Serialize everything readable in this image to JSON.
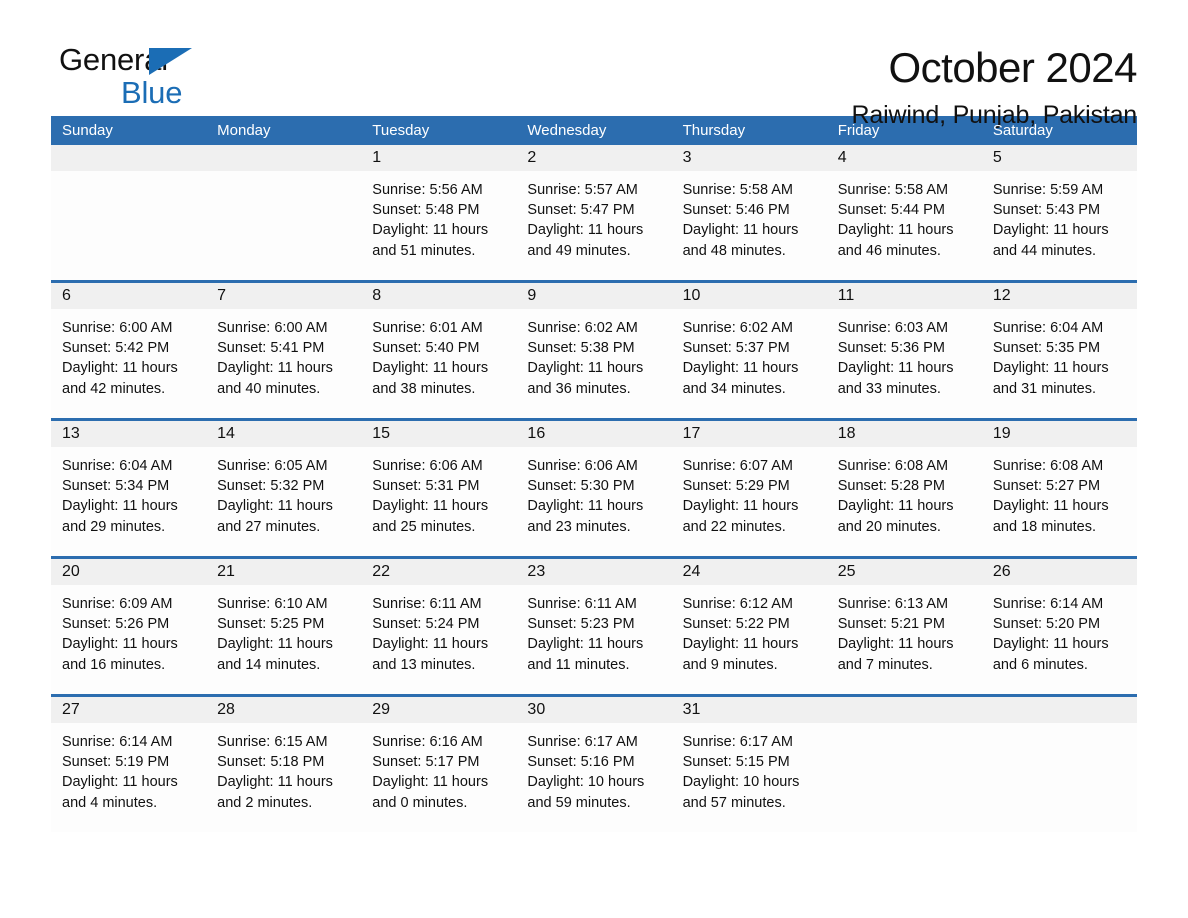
{
  "brand": {
    "word_one": "General",
    "word_two": "Blue",
    "triangle_color": "#1B6DB5"
  },
  "header": {
    "title": "October 2024",
    "subtitle": "Raiwind, Punjab, Pakistan"
  },
  "colors": {
    "header_blue": "#2C6DAF",
    "week_separator": "#2C6DAF",
    "daynum_band": "#F0F0F0",
    "cell_background": "#FDFDFD",
    "text": "#111111",
    "header_text": "#FFFFFF"
  },
  "calendar": {
    "day_headers": [
      "Sunday",
      "Monday",
      "Tuesday",
      "Wednesday",
      "Thursday",
      "Friday",
      "Saturday"
    ],
    "weeks": [
      {
        "days": [
          {
            "num": "",
            "empty": true
          },
          {
            "num": "",
            "empty": true
          },
          {
            "num": "1",
            "sunrise": "Sunrise: 5:56 AM",
            "sunset": "Sunset: 5:48 PM",
            "daylight_1": "Daylight: 11 hours",
            "daylight_2": "and 51 minutes."
          },
          {
            "num": "2",
            "sunrise": "Sunrise: 5:57 AM",
            "sunset": "Sunset: 5:47 PM",
            "daylight_1": "Daylight: 11 hours",
            "daylight_2": "and 49 minutes."
          },
          {
            "num": "3",
            "sunrise": "Sunrise: 5:58 AM",
            "sunset": "Sunset: 5:46 PM",
            "daylight_1": "Daylight: 11 hours",
            "daylight_2": "and 48 minutes."
          },
          {
            "num": "4",
            "sunrise": "Sunrise: 5:58 AM",
            "sunset": "Sunset: 5:44 PM",
            "daylight_1": "Daylight: 11 hours",
            "daylight_2": "and 46 minutes."
          },
          {
            "num": "5",
            "sunrise": "Sunrise: 5:59 AM",
            "sunset": "Sunset: 5:43 PM",
            "daylight_1": "Daylight: 11 hours",
            "daylight_2": "and 44 minutes."
          }
        ]
      },
      {
        "days": [
          {
            "num": "6",
            "sunrise": "Sunrise: 6:00 AM",
            "sunset": "Sunset: 5:42 PM",
            "daylight_1": "Daylight: 11 hours",
            "daylight_2": "and 42 minutes."
          },
          {
            "num": "7",
            "sunrise": "Sunrise: 6:00 AM",
            "sunset": "Sunset: 5:41 PM",
            "daylight_1": "Daylight: 11 hours",
            "daylight_2": "and 40 minutes."
          },
          {
            "num": "8",
            "sunrise": "Sunrise: 6:01 AM",
            "sunset": "Sunset: 5:40 PM",
            "daylight_1": "Daylight: 11 hours",
            "daylight_2": "and 38 minutes."
          },
          {
            "num": "9",
            "sunrise": "Sunrise: 6:02 AM",
            "sunset": "Sunset: 5:38 PM",
            "daylight_1": "Daylight: 11 hours",
            "daylight_2": "and 36 minutes."
          },
          {
            "num": "10",
            "sunrise": "Sunrise: 6:02 AM",
            "sunset": "Sunset: 5:37 PM",
            "daylight_1": "Daylight: 11 hours",
            "daylight_2": "and 34 minutes."
          },
          {
            "num": "11",
            "sunrise": "Sunrise: 6:03 AM",
            "sunset": "Sunset: 5:36 PM",
            "daylight_1": "Daylight: 11 hours",
            "daylight_2": "and 33 minutes."
          },
          {
            "num": "12",
            "sunrise": "Sunrise: 6:04 AM",
            "sunset": "Sunset: 5:35 PM",
            "daylight_1": "Daylight: 11 hours",
            "daylight_2": "and 31 minutes."
          }
        ]
      },
      {
        "days": [
          {
            "num": "13",
            "sunrise": "Sunrise: 6:04 AM",
            "sunset": "Sunset: 5:34 PM",
            "daylight_1": "Daylight: 11 hours",
            "daylight_2": "and 29 minutes."
          },
          {
            "num": "14",
            "sunrise": "Sunrise: 6:05 AM",
            "sunset": "Sunset: 5:32 PM",
            "daylight_1": "Daylight: 11 hours",
            "daylight_2": "and 27 minutes."
          },
          {
            "num": "15",
            "sunrise": "Sunrise: 6:06 AM",
            "sunset": "Sunset: 5:31 PM",
            "daylight_1": "Daylight: 11 hours",
            "daylight_2": "and 25 minutes."
          },
          {
            "num": "16",
            "sunrise": "Sunrise: 6:06 AM",
            "sunset": "Sunset: 5:30 PM",
            "daylight_1": "Daylight: 11 hours",
            "daylight_2": "and 23 minutes."
          },
          {
            "num": "17",
            "sunrise": "Sunrise: 6:07 AM",
            "sunset": "Sunset: 5:29 PM",
            "daylight_1": "Daylight: 11 hours",
            "daylight_2": "and 22 minutes."
          },
          {
            "num": "18",
            "sunrise": "Sunrise: 6:08 AM",
            "sunset": "Sunset: 5:28 PM",
            "daylight_1": "Daylight: 11 hours",
            "daylight_2": "and 20 minutes."
          },
          {
            "num": "19",
            "sunrise": "Sunrise: 6:08 AM",
            "sunset": "Sunset: 5:27 PM",
            "daylight_1": "Daylight: 11 hours",
            "daylight_2": "and 18 minutes."
          }
        ]
      },
      {
        "days": [
          {
            "num": "20",
            "sunrise": "Sunrise: 6:09 AM",
            "sunset": "Sunset: 5:26 PM",
            "daylight_1": "Daylight: 11 hours",
            "daylight_2": "and 16 minutes."
          },
          {
            "num": "21",
            "sunrise": "Sunrise: 6:10 AM",
            "sunset": "Sunset: 5:25 PM",
            "daylight_1": "Daylight: 11 hours",
            "daylight_2": "and 14 minutes."
          },
          {
            "num": "22",
            "sunrise": "Sunrise: 6:11 AM",
            "sunset": "Sunset: 5:24 PM",
            "daylight_1": "Daylight: 11 hours",
            "daylight_2": "and 13 minutes."
          },
          {
            "num": "23",
            "sunrise": "Sunrise: 6:11 AM",
            "sunset": "Sunset: 5:23 PM",
            "daylight_1": "Daylight: 11 hours",
            "daylight_2": "and 11 minutes."
          },
          {
            "num": "24",
            "sunrise": "Sunrise: 6:12 AM",
            "sunset": "Sunset: 5:22 PM",
            "daylight_1": "Daylight: 11 hours",
            "daylight_2": "and 9 minutes."
          },
          {
            "num": "25",
            "sunrise": "Sunrise: 6:13 AM",
            "sunset": "Sunset: 5:21 PM",
            "daylight_1": "Daylight: 11 hours",
            "daylight_2": "and 7 minutes."
          },
          {
            "num": "26",
            "sunrise": "Sunrise: 6:14 AM",
            "sunset": "Sunset: 5:20 PM",
            "daylight_1": "Daylight: 11 hours",
            "daylight_2": "and 6 minutes."
          }
        ]
      },
      {
        "days": [
          {
            "num": "27",
            "sunrise": "Sunrise: 6:14 AM",
            "sunset": "Sunset: 5:19 PM",
            "daylight_1": "Daylight: 11 hours",
            "daylight_2": "and 4 minutes."
          },
          {
            "num": "28",
            "sunrise": "Sunrise: 6:15 AM",
            "sunset": "Sunset: 5:18 PM",
            "daylight_1": "Daylight: 11 hours",
            "daylight_2": "and 2 minutes."
          },
          {
            "num": "29",
            "sunrise": "Sunrise: 6:16 AM",
            "sunset": "Sunset: 5:17 PM",
            "daylight_1": "Daylight: 11 hours",
            "daylight_2": "and 0 minutes."
          },
          {
            "num": "30",
            "sunrise": "Sunrise: 6:17 AM",
            "sunset": "Sunset: 5:16 PM",
            "daylight_1": "Daylight: 10 hours",
            "daylight_2": "and 59 minutes."
          },
          {
            "num": "31",
            "sunrise": "Sunrise: 6:17 AM",
            "sunset": "Sunset: 5:15 PM",
            "daylight_1": "Daylight: 10 hours",
            "daylight_2": "and 57 minutes."
          },
          {
            "num": "",
            "empty": true
          },
          {
            "num": "",
            "empty": true
          }
        ]
      }
    ]
  }
}
